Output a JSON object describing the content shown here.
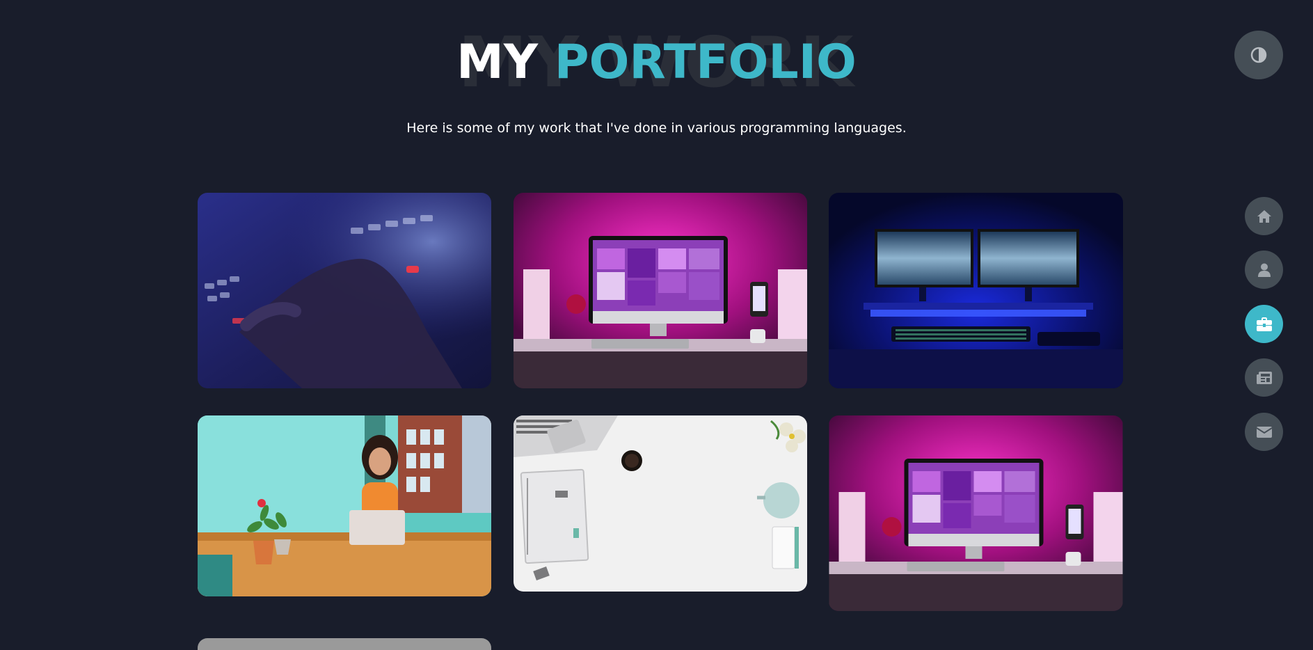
{
  "header": {
    "background_word": "MY WORK",
    "title_prefix": "MY",
    "title_accent": "PORTFOLIO",
    "subtitle": "Here is some of my work that I've done in various programming languages."
  },
  "colors": {
    "background": "#191d2b",
    "accent": "#3eb8c9",
    "button_gray": "#454e56",
    "icon_gray": "#a0a6ac"
  },
  "portfolio": {
    "items": [
      {
        "name": "portfolio-item-keyboard-hand",
        "icon": "image"
      },
      {
        "name": "portfolio-item-pink-desk-setup",
        "icon": "image"
      },
      {
        "name": "portfolio-item-blue-dual-monitors",
        "icon": "image"
      },
      {
        "name": "portfolio-item-woman-laptop",
        "icon": "image"
      },
      {
        "name": "portfolio-item-white-desk-flatlay",
        "icon": "image"
      },
      {
        "name": "portfolio-item-pink-desk-setup-2",
        "icon": "image"
      },
      {
        "name": "portfolio-item-partial",
        "icon": "image"
      }
    ]
  },
  "theme_toggle": {
    "icon": "contrast-icon"
  },
  "nav": {
    "items": [
      {
        "id": "home",
        "icon": "home-icon",
        "active": false
      },
      {
        "id": "about",
        "icon": "user-icon",
        "active": false
      },
      {
        "id": "portfolio",
        "icon": "briefcase-icon",
        "active": true
      },
      {
        "id": "blog",
        "icon": "newspaper-icon",
        "active": false
      },
      {
        "id": "contact",
        "icon": "envelope-icon",
        "active": false
      }
    ]
  }
}
